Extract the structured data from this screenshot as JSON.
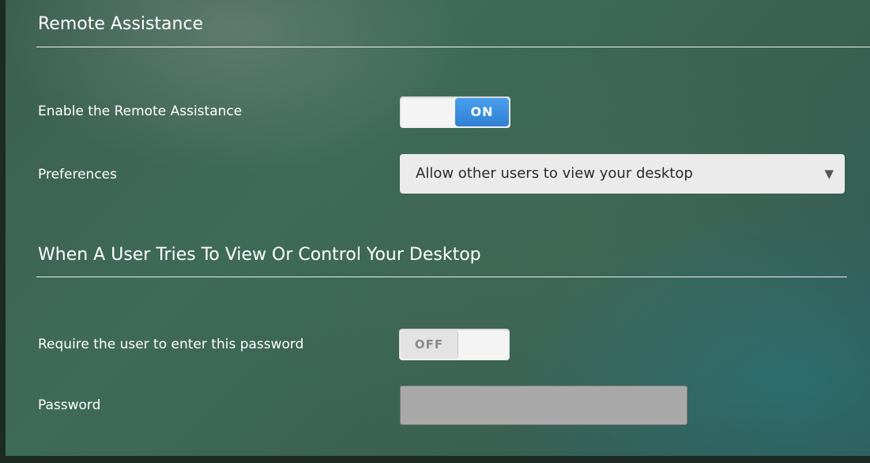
{
  "remote_assistance": {
    "section_title": "Remote Assistance",
    "enable_label": "Enable the Remote Assistance",
    "enable_toggle_state": "ON",
    "preferences_label": "Preferences",
    "preferences_selected": "Allow other users to view your desktop",
    "dropdown_arrow": "▼"
  },
  "control_section": {
    "section_title": "When A User Tries To View Or Control Your Desktop",
    "require_password_label": "Require the user to enter this password",
    "require_password_toggle_state": "OFF",
    "password_label": "Password",
    "password_value": ""
  },
  "colors": {
    "toggle_on": "#3a8ee0",
    "toggle_off_text": "#8a8a8a",
    "password_field_disabled": "#a9a9a9"
  }
}
